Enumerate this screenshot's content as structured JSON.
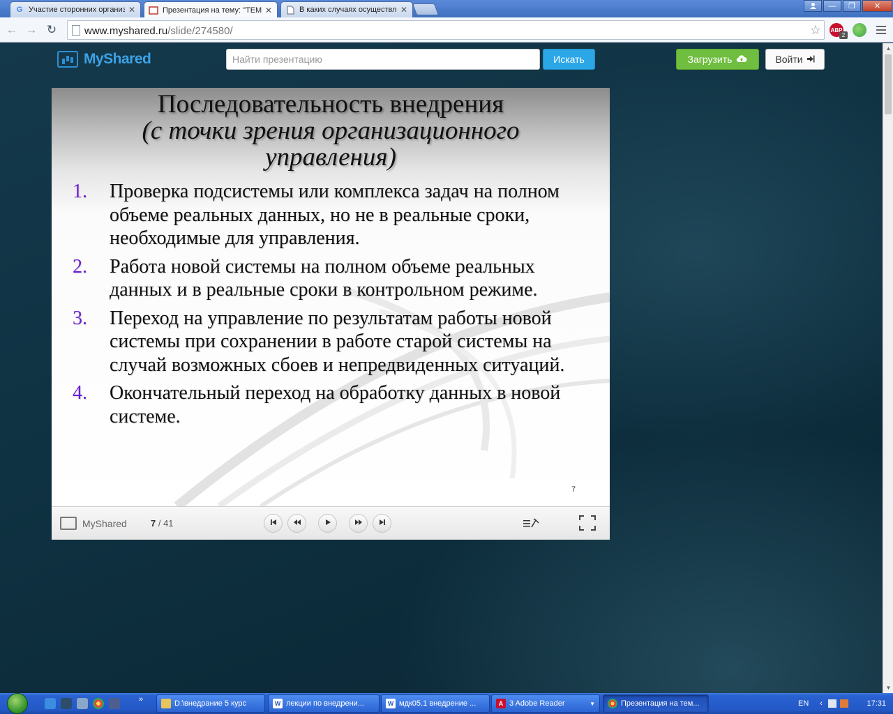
{
  "browser": {
    "tabs": [
      {
        "title": "Участие сторонних организ",
        "favicon": "google-g-icon",
        "active": false
      },
      {
        "title": "Презентация на тему: \"ТЕМ",
        "favicon": "myshared-icon",
        "active": true
      },
      {
        "title": "В каких случаях осуществл",
        "favicon": "page-icon",
        "active": false
      }
    ],
    "url_host": "www.myshared.ru",
    "url_path": "/slide/274580/",
    "extensions": [
      {
        "name": "adblock-icon",
        "label": "ABP",
        "badge": "2",
        "color": "#c8102e"
      },
      {
        "name": "globe-icon",
        "label": "",
        "color": "#3aa346"
      },
      {
        "name": "menu-icon",
        "label": "",
        "color": "#888888"
      }
    ]
  },
  "site": {
    "logo_text": "MyShared",
    "search_placeholder": "Найти презентацию",
    "search_button": "Искать",
    "upload_button": "Загрузить",
    "login_button": "Войти"
  },
  "slide": {
    "title_line1": "Последовательность внедрения",
    "title_line2": "(с точки  зрения организационного управления)",
    "items": [
      {
        "num": "1.",
        "text": "Проверка подсистемы или комплекса задач на полном объеме реальных данных, но не в реальные сроки, необходимые для управления."
      },
      {
        "num": "2.",
        "text": "Работа новой системы на полном объеме реальных данных и в реальные сроки в контрольном режиме."
      },
      {
        "num": "3.",
        "text": "Переход на управление по результатам работы новой системы при сохранении в работе старой системы на случай возможных сбоев и непредвиденных ситуаций."
      },
      {
        "num": "4.",
        "text": "Окончательный переход на обработку данных в новой системе."
      }
    ],
    "page_number": "7"
  },
  "player": {
    "brand": "MyShared",
    "current": "7",
    "total": "41",
    "separator": " / "
  },
  "taskbar": {
    "tasks": [
      {
        "label": "D:\\внедрание 5 курс",
        "icon": "folder-icon",
        "active": false
      },
      {
        "label": "лекции по внедрени...",
        "icon": "word-icon",
        "active": false
      },
      {
        "label": "мдк05.1 внедрение ...",
        "icon": "word-icon",
        "active": false
      },
      {
        "label": "3 Adobe Reader",
        "icon": "adobe-reader-icon",
        "active": false
      },
      {
        "label": "Презентация на тем...",
        "icon": "chrome-icon",
        "active": true
      }
    ],
    "language": "EN",
    "clock": "17:31"
  },
  "colors": {
    "accent_blue": "#2ba7e8",
    "upload_green": "#6fbe3f",
    "list_number_purple": "#6a1fd6"
  }
}
